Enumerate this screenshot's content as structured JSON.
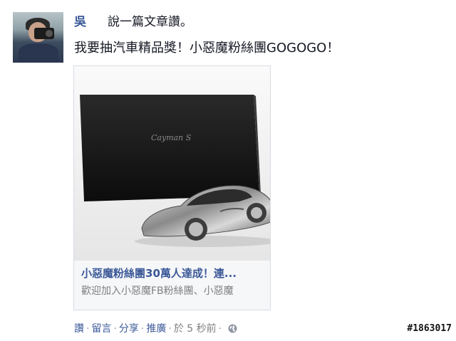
{
  "post": {
    "author": "吳",
    "action_text": "說一篇文章讚。",
    "message": "我要抽汽車精品獎！小惡魔粉絲團GOGOGO！"
  },
  "card": {
    "image_caption": "Cayman S",
    "title": "小惡魔粉絲團30萬人達成！連...",
    "description": "歡迎加入小惡魔FB粉絲團、小惡魔"
  },
  "actions": {
    "read": "讚",
    "comment": "留言",
    "share": "分享",
    "promote": "推廣",
    "time": "於 5 秒前"
  },
  "post_id": "#1863017",
  "colors": {
    "link": "#3b5998",
    "muted": "#7f7f7f"
  },
  "icons": [
    "globe-icon"
  ]
}
